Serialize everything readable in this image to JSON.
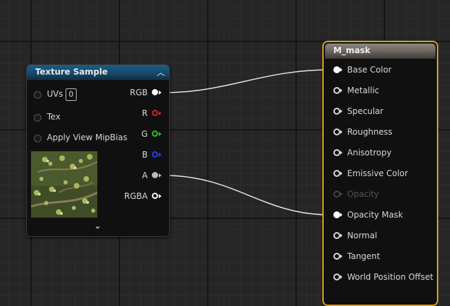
{
  "texture_node": {
    "title": "Texture Sample",
    "inputs": [
      {
        "label": "UVs",
        "value": "0"
      },
      {
        "label": "Tex"
      },
      {
        "label": "Apply View MipBias"
      }
    ],
    "outputs": [
      {
        "label": "RGB",
        "color": "#ffffff"
      },
      {
        "label": "R",
        "color": "#e02020"
      },
      {
        "label": "G",
        "color": "#20d020"
      },
      {
        "label": "B",
        "color": "#2040ff"
      },
      {
        "label": "A",
        "color": "#bbbbbb"
      },
      {
        "label": "RGBA",
        "color": "#ffffff"
      }
    ],
    "preview_icon": "foliage-texture-thumbnail",
    "expand_icon": "chevron-down-icon",
    "collapse_icon": "chevron-up-icon"
  },
  "material_node": {
    "title": "M_mask",
    "accent": "#e0a21c",
    "inputs": [
      {
        "label": "Base Color",
        "connected": true,
        "enabled": true
      },
      {
        "label": "Metallic",
        "connected": false,
        "enabled": true
      },
      {
        "label": "Specular",
        "connected": false,
        "enabled": true
      },
      {
        "label": "Roughness",
        "connected": false,
        "enabled": true
      },
      {
        "label": "Anisotropy",
        "connected": false,
        "enabled": true
      },
      {
        "label": "Emissive Color",
        "connected": false,
        "enabled": true
      },
      {
        "label": "Opacity",
        "connected": false,
        "enabled": false
      },
      {
        "label": "Opacity Mask",
        "connected": true,
        "enabled": true
      },
      {
        "label": "Normal",
        "connected": false,
        "enabled": true
      },
      {
        "label": "Tangent",
        "connected": false,
        "enabled": true
      },
      {
        "label": "World Position Offset",
        "connected": false,
        "enabled": true
      }
    ]
  },
  "connections": [
    {
      "from": "RGB",
      "to": "Base Color"
    },
    {
      "from": "A",
      "to": "Opacity Mask"
    }
  ]
}
